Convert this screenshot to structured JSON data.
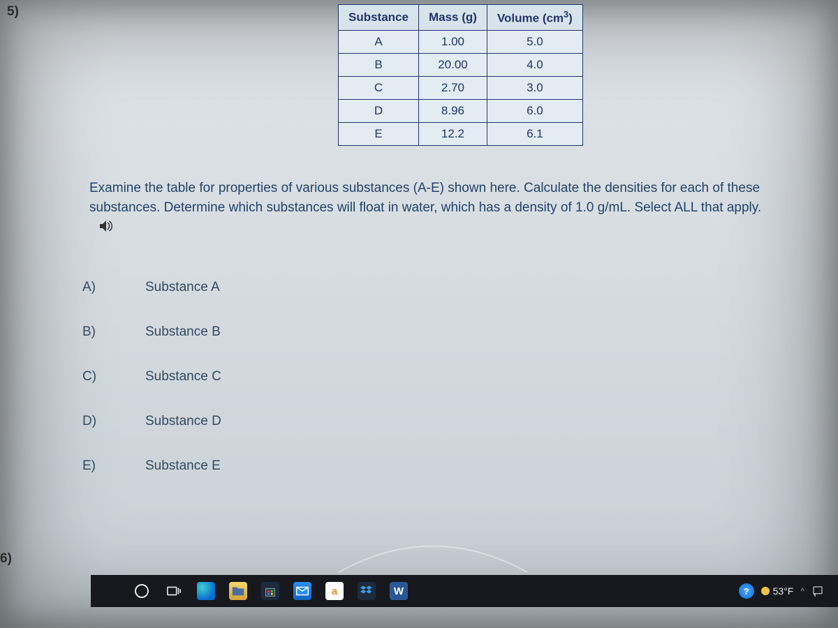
{
  "question_numbers": {
    "q5": "5)",
    "q6": "6)"
  },
  "chart_data": {
    "type": "table",
    "title": "",
    "columns": [
      "Substance",
      "Mass (g)",
      "Volume (cm³)"
    ],
    "rows": [
      {
        "substance": "A",
        "mass": "1.00",
        "volume": "5.0"
      },
      {
        "substance": "B",
        "mass": "20.00",
        "volume": "4.0"
      },
      {
        "substance": "C",
        "mass": "2.70",
        "volume": "3.0"
      },
      {
        "substance": "D",
        "mass": "8.96",
        "volume": "6.0"
      },
      {
        "substance": "E",
        "mass": "12.2",
        "volume": "6.1"
      }
    ]
  },
  "prompt_text": "Examine the table for properties of various substances (A-E) shown here. Calculate the densities for each of these substances. Determine which substances will float in water, which has a density of 1.0 g/mL. Select ALL that apply.",
  "choices": [
    {
      "letter": "A)",
      "label": "Substance A"
    },
    {
      "letter": "B)",
      "label": "Substance B"
    },
    {
      "letter": "C)",
      "label": "Substance C"
    },
    {
      "letter": "D)",
      "label": "Substance D"
    },
    {
      "letter": "E)",
      "label": "Substance E"
    }
  ],
  "taskbar": {
    "icons": {
      "cortana": "cortana",
      "taskview": "task-view",
      "edge": "edge",
      "explorer": "file-explorer",
      "store": "store",
      "mail": "mail",
      "amazon": "a",
      "dropbox": "dropbox",
      "word": "W"
    },
    "right": {
      "meet_now": "?",
      "temp": "53°F",
      "chevron": "^"
    }
  }
}
